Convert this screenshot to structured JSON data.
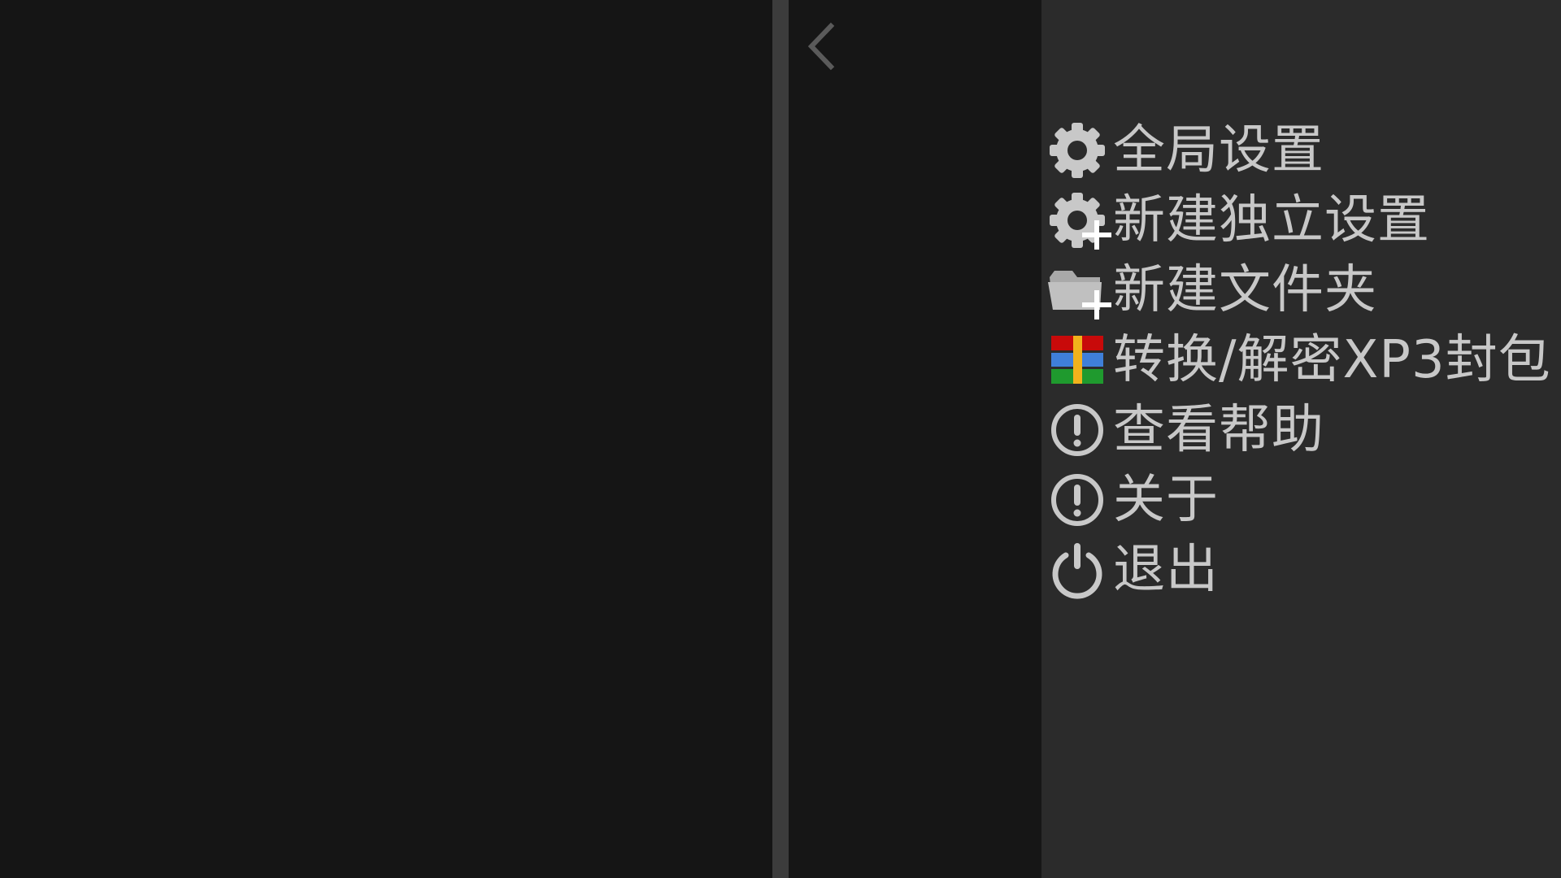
{
  "colors": {
    "left_pane_bg": "#151515",
    "divider": "#3c3c3c",
    "middle_pane_bg": "#161616",
    "menu_bg": "#2b2b2b",
    "text": "#c8c8c8",
    "icon": "#c8c8c8",
    "back_chevron": "#5a5a5a"
  },
  "navigation": {
    "back_icon": "chevron-left-icon"
  },
  "menu": {
    "items": [
      {
        "label": "全局设置",
        "icon": "gear-icon"
      },
      {
        "label": "新建独立设置",
        "icon": "gear-plus-icon"
      },
      {
        "label": "新建文件夹",
        "icon": "folder-plus-icon"
      },
      {
        "label": "转换/解密XP3封包",
        "icon": "archive-icon"
      },
      {
        "label": "查看帮助",
        "icon": "exclamation-circle-icon"
      },
      {
        "label": "关于",
        "icon": "exclamation-circle-icon"
      },
      {
        "label": "退出",
        "icon": "power-icon"
      }
    ]
  }
}
